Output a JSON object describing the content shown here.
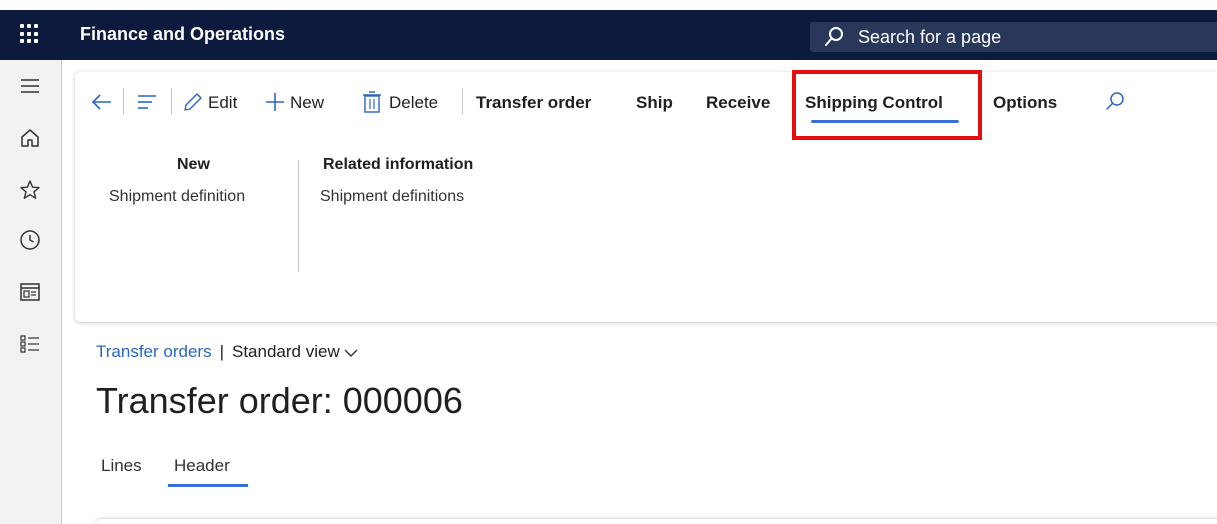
{
  "app": {
    "title": "Finance and Operations",
    "search_placeholder": "Search for a page"
  },
  "leftnav": {
    "items": [
      "hamburger-icon",
      "home-icon",
      "star-icon",
      "clock-icon",
      "workspace-icon",
      "modules-icon"
    ]
  },
  "actionpane": {
    "edit_label": "Edit",
    "new_label": "New",
    "delete_label": "Delete",
    "tabs": [
      "Transfer order",
      "Ship",
      "Receive",
      "Shipping Control",
      "Options"
    ],
    "active_tab": "Shipping Control",
    "groups": [
      {
        "title": "New",
        "items": [
          "Shipment definition"
        ]
      },
      {
        "title": "Related information",
        "items": [
          "Shipment definitions"
        ]
      }
    ]
  },
  "breadcrumb": {
    "link": "Transfer orders",
    "separator": "|",
    "view": "Standard view"
  },
  "page": {
    "title": "Transfer order: 000006",
    "tabs": [
      "Lines",
      "Header"
    ],
    "active_tab": "Header"
  },
  "colors": {
    "topbar": "#0b1a3d",
    "accent": "#3a6fd8",
    "link": "#2b65c4",
    "highlight": "#e50d0d"
  }
}
